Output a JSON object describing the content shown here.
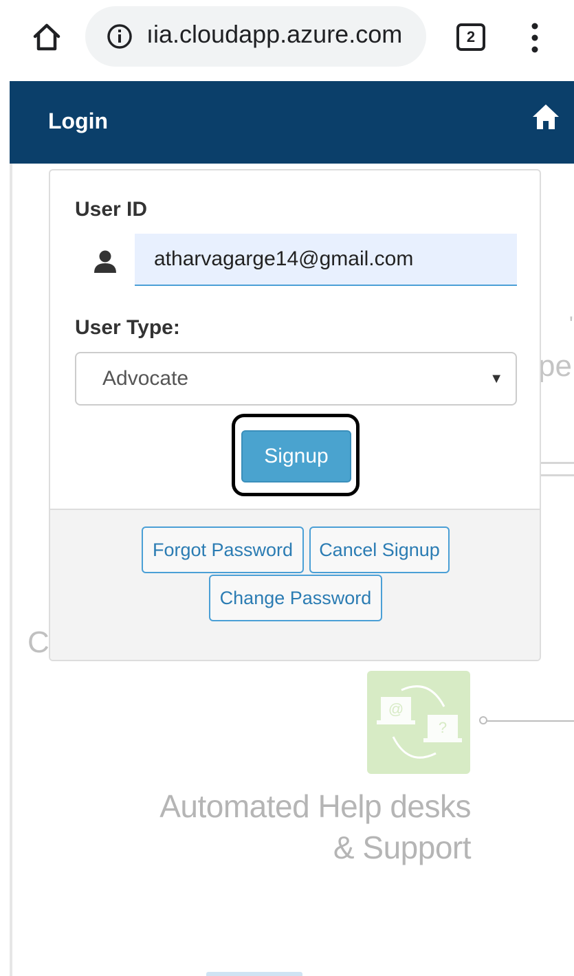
{
  "browser": {
    "url": "ıia.cloudapp.azure.com",
    "tab_count": "2",
    "icons": [
      "home-icon",
      "info-icon",
      "tabs-icon",
      "more-menu-icon"
    ]
  },
  "navbar": {
    "title": "Login",
    "home_icon": "home-icon",
    "background": "#0b3f6a"
  },
  "login_form": {
    "user_id_label": "User ID",
    "user_id_value": "atharvagarge14@gmail.com",
    "user_type_label": "User Type:",
    "user_type_selected": "Advocate",
    "signup_label": "Signup",
    "signup_color": "#4aa3cf"
  },
  "footer_links": {
    "forgot_password": "Forgot Password",
    "cancel_signup": "Cancel Signup",
    "change_password": "Change Password"
  },
  "background_content": {
    "right_fragment": "pe",
    "left_fragment": "C",
    "feature_caption_line1": "Automated Help desks",
    "feature_caption_line2": "& Support"
  }
}
